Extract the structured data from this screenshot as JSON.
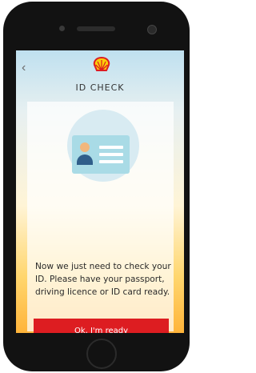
{
  "header": {
    "back_icon": "chevron-left-icon",
    "logo": "shell-logo",
    "title": "ID CHECK"
  },
  "illustration": {
    "icon": "id-card-icon"
  },
  "message": "Now we just need to check your ID. Please have your passport, driving licence or ID card ready.",
  "primary_action": {
    "label": "Ok, I'm ready"
  },
  "colors": {
    "accent": "#dd1d21",
    "logo_red": "#dd1d21",
    "logo_yellow": "#fbce07"
  }
}
